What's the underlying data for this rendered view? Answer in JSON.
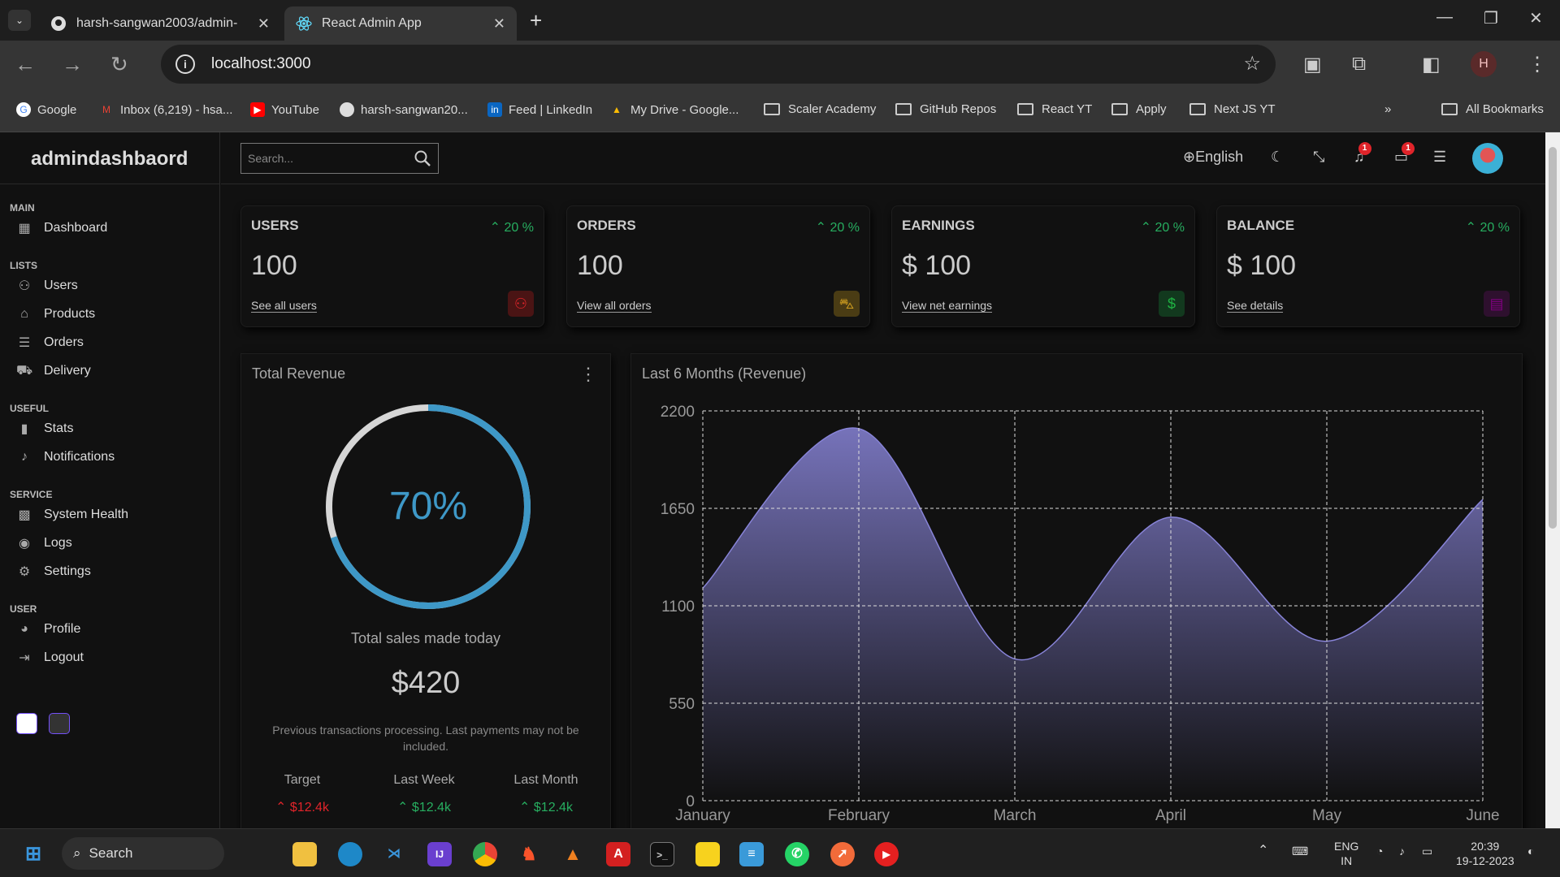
{
  "browser": {
    "tabs": [
      {
        "title": "harsh-sangwan2003/admin-",
        "active": false
      },
      {
        "title": "React Admin App",
        "active": true
      }
    ],
    "url": "localhost:3000",
    "profile_initial": "H",
    "bookmarks": [
      {
        "label": "Google",
        "icon": "google-icon"
      },
      {
        "label": "Inbox (6,219) - hsa...",
        "icon": "gmail-icon"
      },
      {
        "label": "YouTube",
        "icon": "youtube-icon"
      },
      {
        "label": "harsh-sangwan20...",
        "icon": "github-icon"
      },
      {
        "label": "Feed | LinkedIn",
        "icon": "linkedin-icon"
      },
      {
        "label": "My Drive - Google...",
        "icon": "drive-icon"
      },
      {
        "label": "Scaler Academy",
        "icon": "folder-icon"
      },
      {
        "label": "GitHub Repos",
        "icon": "folder-icon"
      },
      {
        "label": "React YT",
        "icon": "folder-icon"
      },
      {
        "label": "Apply",
        "icon": "folder-icon"
      },
      {
        "label": "Next JS YT",
        "icon": "folder-icon"
      }
    ],
    "all_bookmarks": "All Bookmarks"
  },
  "sidebar": {
    "logo": "admindashbaord",
    "sections": [
      {
        "title": "MAIN",
        "items": [
          {
            "label": "Dashboard",
            "icon": "dashboard-icon"
          }
        ]
      },
      {
        "title": "LISTS",
        "items": [
          {
            "label": "Users",
            "icon": "user-icon"
          },
          {
            "label": "Products",
            "icon": "store-icon"
          },
          {
            "label": "Orders",
            "icon": "list-icon"
          },
          {
            "label": "Delivery",
            "icon": "truck-icon"
          }
        ]
      },
      {
        "title": "USEFUL",
        "items": [
          {
            "label": "Stats",
            "icon": "bar-chart-icon"
          },
          {
            "label": "Notifications",
            "icon": "bell-icon"
          }
        ]
      },
      {
        "title": "SERVICE",
        "items": [
          {
            "label": "System Health",
            "icon": "health-icon"
          },
          {
            "label": "Logs",
            "icon": "brain-icon"
          },
          {
            "label": "Settings",
            "icon": "settings-icon"
          }
        ]
      },
      {
        "title": "USER",
        "items": [
          {
            "label": "Profile",
            "icon": "profile-icon"
          },
          {
            "label": "Logout",
            "icon": "logout-icon"
          }
        ]
      }
    ],
    "theme_colors": [
      "#ffffff",
      "#333333"
    ]
  },
  "topbar": {
    "search_placeholder": "Search...",
    "language": "English",
    "notifications_count": "1",
    "messages_count": "1"
  },
  "widgets": [
    {
      "title": "USERS",
      "percent": "20 %",
      "value": "100",
      "link": "See all users",
      "icon": "person-icon",
      "icon_color": "#e0242a",
      "icon_bg": "#4a1414"
    },
    {
      "title": "ORDERS",
      "percent": "20 %",
      "value": "100",
      "link": "View all orders",
      "icon": "cart-icon",
      "icon_color": "#daa520",
      "icon_bg": "#4a3c14"
    },
    {
      "title": "EARNINGS",
      "percent": "20 %",
      "value": "$ 100",
      "link": "View net earnings",
      "icon": "dollar-icon",
      "icon_color": "#1fb142",
      "icon_bg": "#12391e"
    },
    {
      "title": "BALANCE",
      "percent": "20 %",
      "value": "$ 100",
      "link": "See details",
      "icon": "wallet-icon",
      "icon_color": "#800080",
      "icon_bg": "#2e102e"
    }
  ],
  "revenue": {
    "title": "Total Revenue",
    "progress": 70,
    "progress_label": "70%",
    "subtitle": "Total sales made today",
    "amount": "$420",
    "note": "Previous transactions processing. Last payments may not be included.",
    "summary": [
      {
        "label": "Target",
        "value": "$12.4k",
        "trend": "up",
        "color": "#e0242a"
      },
      {
        "label": "Last Week",
        "value": "$12.4k",
        "trend": "up",
        "color": "#27ae60"
      },
      {
        "label": "Last Month",
        "value": "$12.4k",
        "trend": "up",
        "color": "#27ae60"
      }
    ]
  },
  "chart_data": {
    "type": "area",
    "title": "Last 6 Months (Revenue)",
    "categories": [
      "January",
      "February",
      "March",
      "April",
      "May",
      "June"
    ],
    "series": [
      {
        "values": [
          1200,
          2100,
          800,
          1600,
          900,
          1700
        ]
      }
    ],
    "ylim": [
      0,
      2200
    ],
    "yticks": [
      0,
      550,
      1100,
      1650,
      2200
    ],
    "grid": true,
    "colors": {
      "fill": "#8884d8"
    }
  },
  "taskbar": {
    "search_label": "Search",
    "lang_line1": "ENG",
    "lang_line2": "IN",
    "time": "20:39",
    "date": "19-12-2023"
  }
}
